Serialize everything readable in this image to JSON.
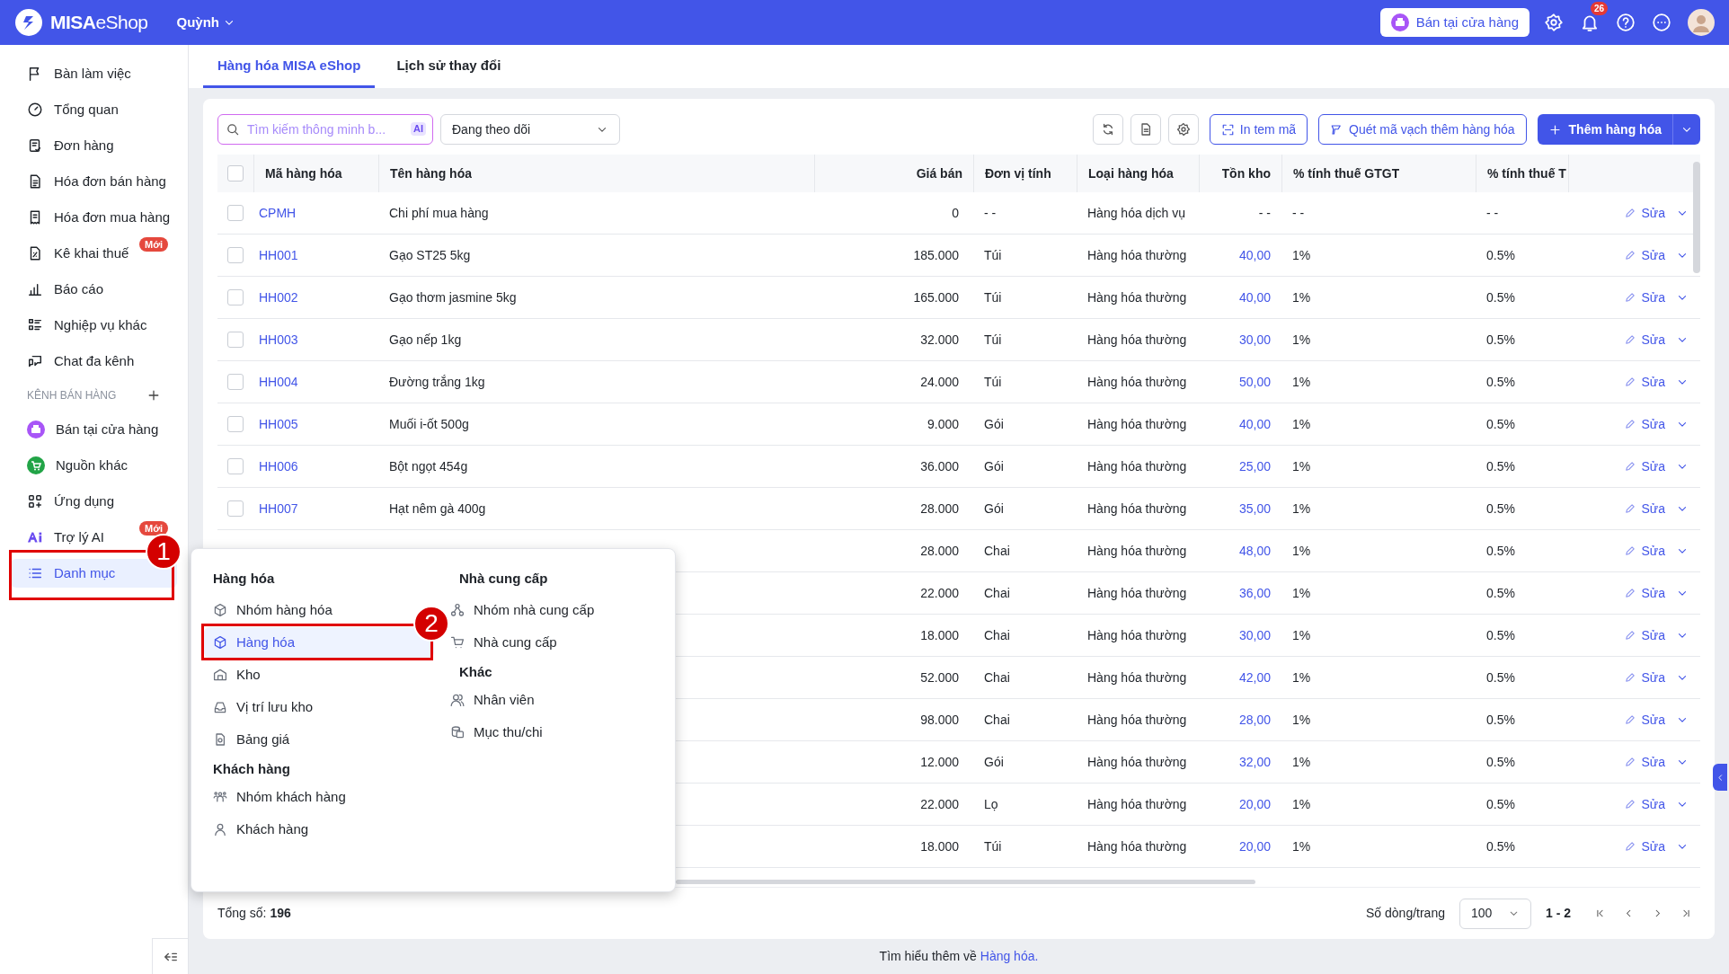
{
  "topbar": {
    "logo": {
      "strong": "MISA",
      "light": "eShop"
    },
    "user": "Quỳnh",
    "store_button": "Bán tại cửa hàng",
    "notification_count": "26"
  },
  "sidebar": {
    "items": [
      {
        "label": "Bàn làm việc",
        "selected": false
      },
      {
        "label": "Tổng quan",
        "selected": false
      },
      {
        "label": "Đơn hàng",
        "selected": false
      },
      {
        "label": "Hóa đơn bán hàng",
        "selected": false
      },
      {
        "label": "Hóa đơn mua hàng",
        "selected": false
      },
      {
        "label": "Kê khai thuế",
        "badge": "Mới",
        "selected": false
      },
      {
        "label": "Báo cáo",
        "selected": false
      },
      {
        "label": "Nghiệp vụ khác",
        "selected": false
      },
      {
        "label": "Chat đa kênh",
        "selected": false
      }
    ],
    "channels_header": "KÊNH BÁN HÀNG",
    "channels": [
      {
        "label": "Bán tại cửa hàng",
        "color": "#a855f7",
        "selected": false
      },
      {
        "label": "Nguồn khác",
        "color": "#22a447",
        "selected": false
      }
    ],
    "extra_items": [
      {
        "label": "Ứng dụng",
        "selected": false
      },
      {
        "label": "Trợ lý AI",
        "badge": "Mới",
        "selected": false
      },
      {
        "label": "Danh mục",
        "selected": true
      }
    ]
  },
  "tabs": [
    {
      "label": "Hàng hóa MISA eShop",
      "selected": true
    },
    {
      "label": "Lịch sử thay đổi",
      "selected": false
    }
  ],
  "toolbar": {
    "search": {
      "placeholder": "Tìm kiếm thông minh b...",
      "badge": "AI"
    },
    "filter": "Đang theo dõi",
    "buttons": [
      "In tem mã",
      "Quét mã vạch thêm hàng hóa"
    ],
    "primary_button": "Thêm hàng hóa"
  },
  "table": {
    "header_checked": false,
    "columns": [
      "Mã hàng hóa",
      "Tên hàng hóa",
      "Giá bán",
      "Đơn vị tính",
      "Loại hàng hóa",
      "Tồn kho",
      "% tính thuế GTGT",
      "% tính thuế T"
    ],
    "rows": [
      {
        "checked": false,
        "code": "CPMH",
        "name": "Chi phí mua hàng",
        "price": "0",
        "unit": "- -",
        "type": "Hàng hóa dịch vụ",
        "stock": "- -",
        "stock_linked": false,
        "vat": "- -",
        "tax2": "- -",
        "edit": "Sửa"
      },
      {
        "checked": false,
        "code": "HH001",
        "name": "Gạo ST25 5kg",
        "price": "185.000",
        "unit": "Túi",
        "type": "Hàng hóa thường",
        "stock": "40,00",
        "stock_linked": true,
        "vat": "1%",
        "tax2": "0.5%",
        "edit": "Sửa"
      },
      {
        "checked": false,
        "code": "HH002",
        "name": "Gạo thơm jasmine 5kg",
        "price": "165.000",
        "unit": "Túi",
        "type": "Hàng hóa thường",
        "stock": "40,00",
        "stock_linked": true,
        "vat": "1%",
        "tax2": "0.5%",
        "edit": "Sửa"
      },
      {
        "checked": false,
        "code": "HH003",
        "name": "Gạo nếp 1kg",
        "price": "32.000",
        "unit": "Túi",
        "type": "Hàng hóa thường",
        "stock": "30,00",
        "stock_linked": true,
        "vat": "1%",
        "tax2": "0.5%",
        "edit": "Sửa"
      },
      {
        "checked": false,
        "code": "HH004",
        "name": "Đường trắng 1kg",
        "price": "24.000",
        "unit": "Túi",
        "type": "Hàng hóa thường",
        "stock": "50,00",
        "stock_linked": true,
        "vat": "1%",
        "tax2": "0.5%",
        "edit": "Sửa"
      },
      {
        "checked": false,
        "code": "HH005",
        "name": "Muối i-ốt 500g",
        "price": "9.000",
        "unit": "Gói",
        "type": "Hàng hóa thường",
        "stock": "40,00",
        "stock_linked": true,
        "vat": "1%",
        "tax2": "0.5%",
        "edit": "Sửa"
      },
      {
        "checked": false,
        "code": "HH006",
        "name": "Bột ngọt 454g",
        "price": "36.000",
        "unit": "Gói",
        "type": "Hàng hóa thường",
        "stock": "25,00",
        "stock_linked": true,
        "vat": "1%",
        "tax2": "0.5%",
        "edit": "Sửa"
      },
      {
        "checked": false,
        "code": "HH007",
        "name": "Hạt nêm gà 400g",
        "price": "28.000",
        "unit": "Gói",
        "type": "Hàng hóa thường",
        "stock": "35,00",
        "stock_linked": true,
        "vat": "1%",
        "tax2": "0.5%",
        "edit": "Sửa"
      },
      {
        "price": "28.000",
        "unit": "Chai",
        "type": "Hàng hóa thường",
        "stock": "48,00",
        "stock_linked": true,
        "vat": "1%",
        "tax2": "0.5%",
        "edit": "Sửa"
      },
      {
        "price": "22.000",
        "unit": "Chai",
        "type": "Hàng hóa thường",
        "stock": "36,00",
        "stock_linked": true,
        "vat": "1%",
        "tax2": "0.5%",
        "edit": "Sửa"
      },
      {
        "price": "18.000",
        "unit": "Chai",
        "type": "Hàng hóa thường",
        "stock": "30,00",
        "stock_linked": true,
        "vat": "1%",
        "tax2": "0.5%",
        "edit": "Sửa"
      },
      {
        "price": "52.000",
        "unit": "Chai",
        "type": "Hàng hóa thường",
        "stock": "42,00",
        "stock_linked": true,
        "vat": "1%",
        "tax2": "0.5%",
        "edit": "Sửa"
      },
      {
        "price": "98.000",
        "unit": "Chai",
        "type": "Hàng hóa thường",
        "stock": "28,00",
        "stock_linked": true,
        "vat": "1%",
        "tax2": "0.5%",
        "edit": "Sửa"
      },
      {
        "price": "12.000",
        "unit": "Gói",
        "type": "Hàng hóa thường",
        "stock": "32,00",
        "stock_linked": true,
        "vat": "1%",
        "tax2": "0.5%",
        "edit": "Sửa"
      },
      {
        "price": "22.000",
        "unit": "Lọ",
        "type": "Hàng hóa thường",
        "stock": "20,00",
        "stock_linked": true,
        "vat": "1%",
        "tax2": "0.5%",
        "edit": "Sửa"
      },
      {
        "price": "18.000",
        "unit": "Túi",
        "type": "Hàng hóa thường",
        "stock": "20,00",
        "stock_linked": true,
        "vat": "1%",
        "tax2": "0.5%",
        "edit": "Sửa"
      }
    ]
  },
  "pager": {
    "total": "Tổng số: **196**",
    "rows_label": "Số dòng/trang",
    "page_size": "100",
    "range": "1 - 2"
  },
  "footer": {
    "text": "Tìm hiểu thêm về",
    "link": "Hàng hóa."
  },
  "menu": {
    "columns": [
      {
        "groups": [
          {
            "title": "Hàng hóa",
            "items": [
              {
                "label": "Nhóm hàng hóa",
                "selected": false
              },
              {
                "label": "Hàng hóa",
                "selected": true
              },
              {
                "label": "Kho",
                "selected": false
              },
              {
                "label": "Vị trí lưu kho",
                "selected": false
              },
              {
                "label": "Bảng giá",
                "selected": false
              }
            ]
          },
          {
            "title": "Khách hàng",
            "items": [
              {
                "label": "Nhóm khách hàng",
                "selected": false
              },
              {
                "label": "Khách hàng",
                "selected": false
              }
            ]
          }
        ]
      },
      {
        "groups": [
          {
            "title": "Nhà cung cấp",
            "items": [
              {
                "label": "Nhóm nhà cung cấp",
                "selected": false
              },
              {
                "label": "Nhà cung cấp",
                "selected": false
              }
            ]
          },
          {
            "title": "Khác",
            "items": [
              {
                "label": "Nhân viên",
                "selected": false
              },
              {
                "label": "Mục thu/chi",
                "selected": false
              }
            ]
          }
        ]
      }
    ]
  },
  "callouts": [
    "1",
    "2"
  ]
}
